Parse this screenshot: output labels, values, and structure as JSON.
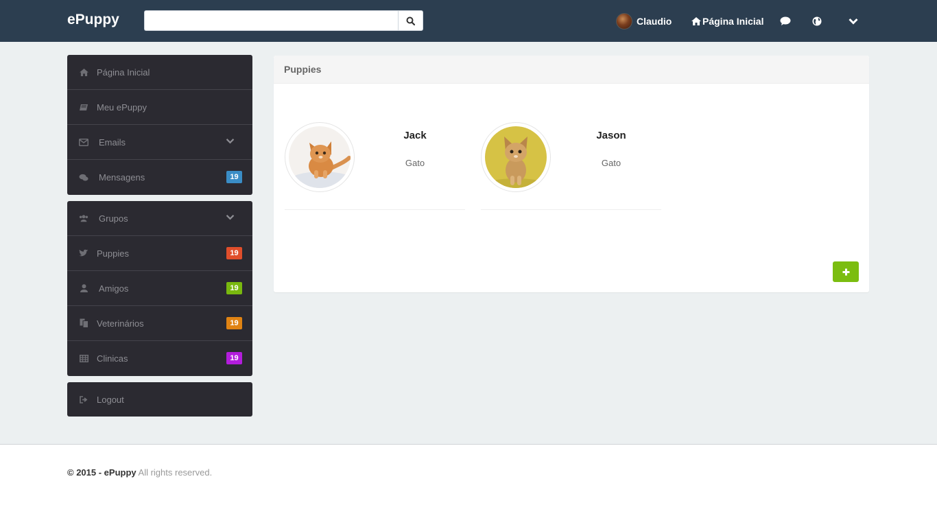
{
  "navbar": {
    "brand": "ePuppy",
    "search": {
      "value": "",
      "placeholder": ""
    },
    "user_name": "Claudio",
    "home_label": "Página Inicial",
    "icons": [
      "search-icon",
      "chat-bubble-icon",
      "globe-icon",
      "chevron-down-icon",
      "home-icon"
    ]
  },
  "sidebar": {
    "items": [
      {
        "label": "Página Inicial",
        "icon": "home-icon"
      },
      {
        "label": "Meu ePuppy",
        "icon": "book-icon"
      },
      {
        "label": "Emails",
        "icon": "envelope-icon",
        "expandable": true
      },
      {
        "label": "Mensagens",
        "icon": "comments-icon",
        "badge": "19",
        "badge_color": "#3a8dc6"
      }
    ],
    "groups": [
      {
        "label": "Grupos",
        "icon": "users-icon",
        "expandable": true
      },
      {
        "label": "Puppies",
        "icon": "twitter-bird-icon",
        "badge": "19",
        "badge_color": "#e04e2b"
      },
      {
        "label": "Amigos",
        "icon": "user-icon",
        "badge": "19",
        "badge_color": "#79b80f"
      },
      {
        "label": "Veterinários",
        "icon": "copy-icon",
        "badge": "19",
        "badge_color": "#e08313"
      },
      {
        "label": "Clinicas",
        "icon": "table-icon",
        "badge": "19",
        "badge_color": "#b31ddc"
      }
    ],
    "logout": {
      "label": "Logout",
      "icon": "sign-out-icon"
    }
  },
  "panel": {
    "title": "Puppies",
    "pets": [
      {
        "name": "Jack",
        "type": "Gato"
      },
      {
        "name": "Jason",
        "type": "Gato"
      }
    ],
    "add_icon": "plus-icon"
  },
  "footer": {
    "copyright": "© 2015 - ePuppy",
    "rights": "All rights reserved."
  },
  "colors": {
    "navbar": "#2c3e50",
    "sidebar": "#2b2a31",
    "background": "#ecf0f1",
    "add_button": "#7bbd10"
  }
}
